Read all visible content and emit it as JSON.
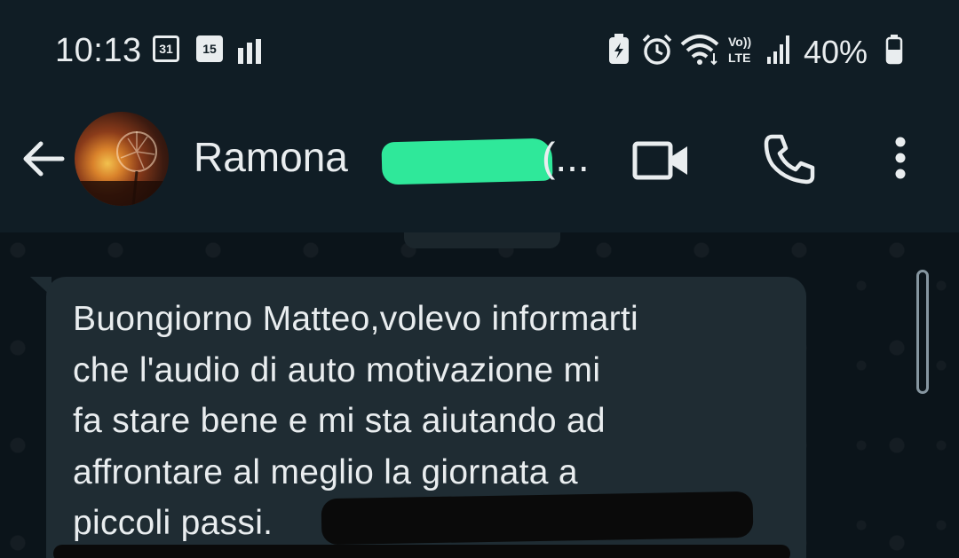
{
  "status_bar": {
    "time": "10:13",
    "calendar_day_1": "31",
    "calendar_day_2": "15",
    "battery_percent": "40%",
    "icons": [
      "calendar-icon",
      "calendar-filled-icon",
      "signal-bars-icon",
      "battery-saver-icon",
      "alarm-icon",
      "wifi-icon",
      "volte-icon",
      "cell-signal-icon",
      "battery-icon"
    ]
  },
  "header": {
    "contact_name": "Ramona",
    "name_suffix": "(...",
    "icons": [
      "back-arrow-icon",
      "video-call-icon",
      "voice-call-icon",
      "more-vert-icon"
    ]
  },
  "message": {
    "lines": [
      "Buongiorno Matteo,volevo informarti",
      "che l'audio di auto motivazione mi",
      "fa stare bene e mi sta aiutando ad",
      "affrontare al meglio la giornata a",
      "piccoli passi."
    ]
  },
  "colors": {
    "header_bg": "#101d25",
    "chat_bg": "#0b141a",
    "bubble_bg": "#1f2c33",
    "redaction_green": "#2fe89a",
    "text": "#e9edef"
  }
}
